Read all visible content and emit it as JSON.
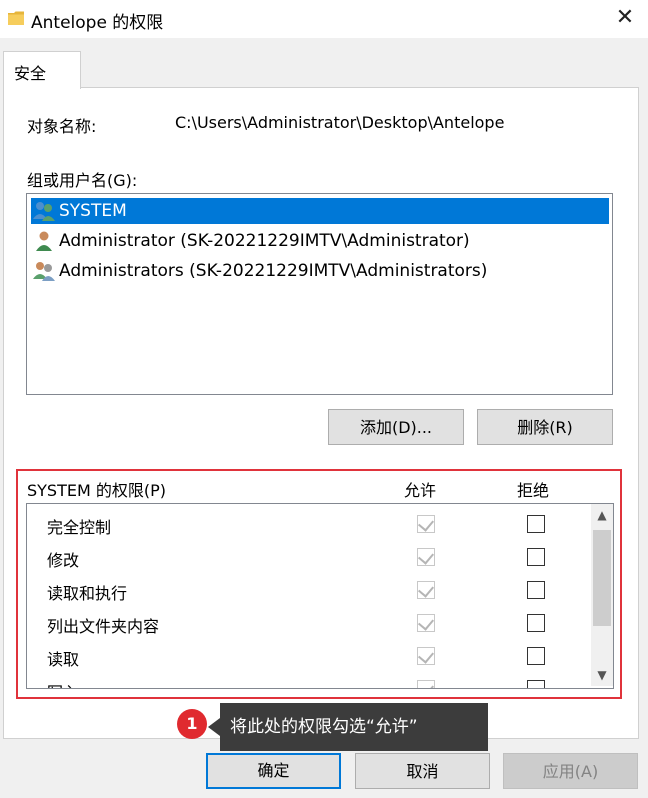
{
  "window": {
    "title": "Antelope 的权限",
    "close_glyph": "✕"
  },
  "tab": {
    "label": "安全"
  },
  "object": {
    "label": "对象名称:",
    "value": "C:\\Users\\Administrator\\Desktop\\Antelope"
  },
  "groups": {
    "label": "组或用户名(G):",
    "items": [
      {
        "name": "SYSTEM",
        "icon": "users-group-icon",
        "selected": true
      },
      {
        "name": "Administrator (SK-20221229IMTV\\Administrator)",
        "icon": "user-icon",
        "selected": false
      },
      {
        "name": "Administrators (SK-20221229IMTV\\Administrators)",
        "icon": "users-group-icon",
        "selected": false
      }
    ]
  },
  "buttons": {
    "add": "添加(D)...",
    "remove": "删除(R)",
    "ok": "确定",
    "cancel": "取消",
    "apply": "应用(A)"
  },
  "permissions": {
    "label": "SYSTEM 的权限(P)",
    "allow_header": "允许",
    "deny_header": "拒绝",
    "rows": [
      {
        "name": "完全控制",
        "allow": true,
        "deny": false
      },
      {
        "name": "修改",
        "allow": true,
        "deny": false
      },
      {
        "name": "读取和执行",
        "allow": true,
        "deny": false
      },
      {
        "name": "列出文件夹内容",
        "allow": true,
        "deny": false
      },
      {
        "name": "读取",
        "allow": true,
        "deny": false
      },
      {
        "name": "写入",
        "allow": true,
        "deny": false
      }
    ]
  },
  "annotation": {
    "badge": "1",
    "text": "将此处的权限勾选“允许”",
    "highlight_color": "#e0333b"
  },
  "colors": {
    "selection": "#0078d7",
    "badge": "#e02a2f"
  }
}
